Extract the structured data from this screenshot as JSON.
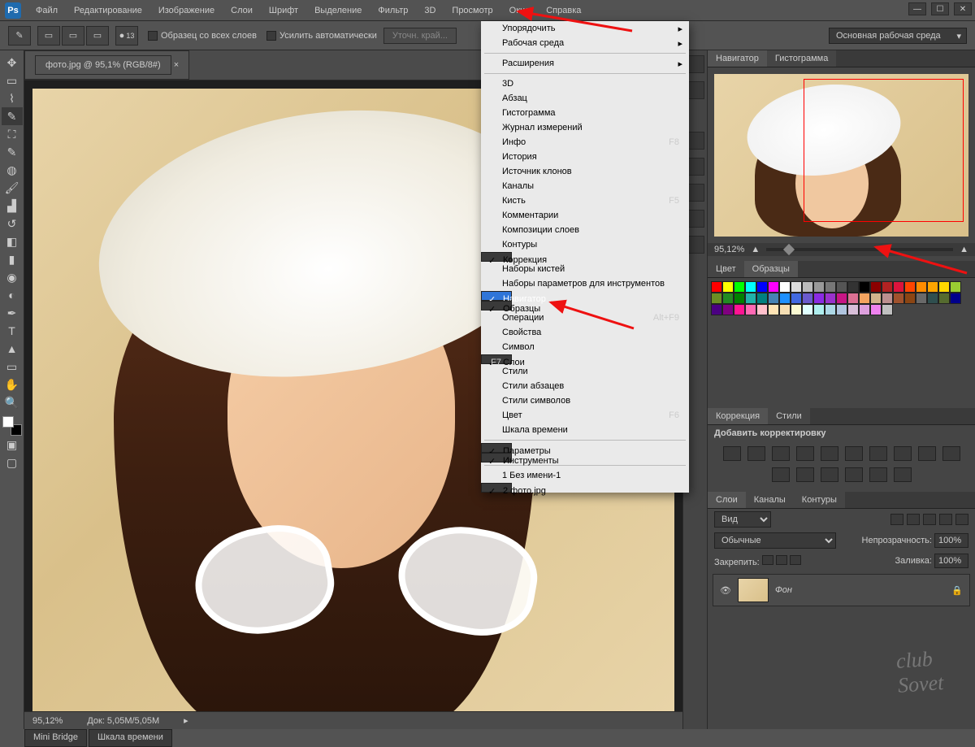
{
  "menubar": [
    "Файл",
    "Редактирование",
    "Изображение",
    "Слои",
    "Шрифт",
    "Выделение",
    "Фильтр",
    "3D",
    "Просмотр",
    "Окно",
    "Справка"
  ],
  "optbar": {
    "brush_size": "13",
    "chk1": "Образец со всех слоев",
    "chk2": "Усилить автоматически",
    "btn1": "Уточн. край...",
    "workspace": "Основная рабочая среда"
  },
  "doc_tab": "фото.jpg @ 95,1% (RGB/8#)",
  "dropdown": [
    {
      "t": "Упорядочить",
      "sub": true
    },
    {
      "t": "Рабочая среда",
      "sub": true
    },
    {
      "sep": true
    },
    {
      "t": "Расширения",
      "sub": true
    },
    {
      "sep": true
    },
    {
      "t": "3D"
    },
    {
      "t": "Абзац"
    },
    {
      "t": "Гистограмма"
    },
    {
      "t": "Журнал измерений"
    },
    {
      "t": "Инфо",
      "sc": "F8"
    },
    {
      "t": "История"
    },
    {
      "t": "Источник клонов"
    },
    {
      "t": "Каналы"
    },
    {
      "t": "Кисть",
      "sc": "F5"
    },
    {
      "t": "Комментарии"
    },
    {
      "t": "Композиции слоев"
    },
    {
      "t": "Контуры"
    },
    {
      "t": "Коррекция",
      "chk": true
    },
    {
      "t": "Наборы кистей"
    },
    {
      "t": "Наборы параметров для инструментов"
    },
    {
      "t": "Навигатор",
      "chk": true,
      "sel": true
    },
    {
      "t": "Образцы",
      "chk": true
    },
    {
      "t": "Операции",
      "sc": "Alt+F9"
    },
    {
      "t": "Свойства"
    },
    {
      "t": "Символ"
    },
    {
      "t": "Слои",
      "chk": true,
      "sc": "F7"
    },
    {
      "t": "Стили"
    },
    {
      "t": "Стили абзацев"
    },
    {
      "t": "Стили символов"
    },
    {
      "t": "Цвет",
      "sc": "F6"
    },
    {
      "t": "Шкала времени"
    },
    {
      "sep": true
    },
    {
      "t": "Параметры",
      "chk": true
    },
    {
      "t": "Инструменты",
      "chk": true
    },
    {
      "sep": true
    },
    {
      "t": "1 Без имени-1"
    },
    {
      "t": "2 фото.jpg",
      "chk": true
    }
  ],
  "right": {
    "nav_tab": "Навигатор",
    "hist_tab": "Гистограмма",
    "zoom": "95,12%",
    "color_tab": "Цвет",
    "swatch_tab": "Образцы",
    "corr_tab": "Коррекция",
    "styles_tab": "Стили",
    "add_corr": "Добавить корректировку",
    "layers_tab": "Слои",
    "channels_tab": "Каналы",
    "paths_tab": "Контуры",
    "kind": "Вид",
    "blend": "Обычные",
    "opacity_lbl": "Непрозрачность:",
    "opacity_val": "100%",
    "lock_lbl": "Закрепить:",
    "fill_lbl": "Заливка:",
    "fill_val": "100%",
    "layer_name": "Фон"
  },
  "status": {
    "zoom": "95,12%",
    "docsize": "Док: 5,05M/5,05M"
  },
  "bottom_tabs": [
    "Mini Bridge",
    "Шкала времени"
  ],
  "swatch_colors": [
    "#ff0000",
    "#ffff00",
    "#00ff00",
    "#00ffff",
    "#0000ff",
    "#ff00ff",
    "#ffffff",
    "#dddddd",
    "#bbbbbb",
    "#999999",
    "#777777",
    "#555555",
    "#333333",
    "#000000",
    "#8b0000",
    "#b22222",
    "#dc143c",
    "#ff4500",
    "#ff8c00",
    "#ffa500",
    "#ffd700",
    "#9acd32",
    "#6b8e23",
    "#228b22",
    "#008000",
    "#20b2aa",
    "#008080",
    "#4682b4",
    "#1e90ff",
    "#4169e1",
    "#6a5acd",
    "#8a2be2",
    "#9932cc",
    "#c71585",
    "#db7093",
    "#f4a460",
    "#d2b48c",
    "#bc8f8f",
    "#a0522d",
    "#8b4513",
    "#696969",
    "#2f4f4f",
    "#556b2f",
    "#00008b",
    "#4b0082",
    "#800080",
    "#ff1493",
    "#ff69b4",
    "#ffc0cb",
    "#ffe4b5",
    "#f5deb3",
    "#fafad2",
    "#e0ffff",
    "#afeeee",
    "#add8e6",
    "#b0c4de",
    "#d8bfd8",
    "#dda0dd",
    "#ee82ee",
    "#c0c0c0"
  ]
}
